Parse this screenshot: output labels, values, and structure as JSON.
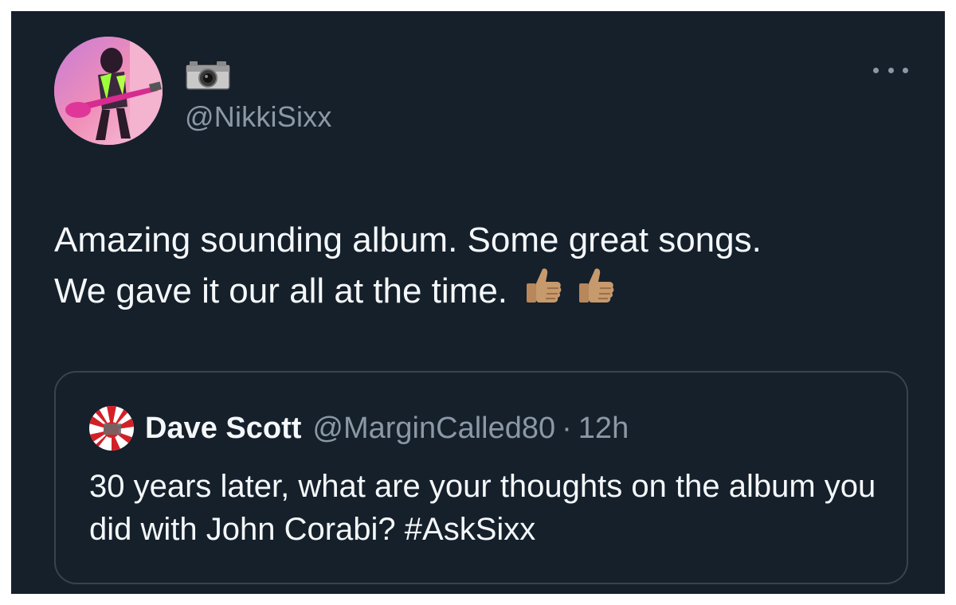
{
  "tweet": {
    "handle": "@NikkiSixx",
    "name_icons": [
      "camera-icon"
    ],
    "text": "Amazing sounding album. Some great songs.\nWe gave it our all at the time.",
    "emojis": [
      "thumbs-up-icon",
      "thumbs-up-icon"
    ],
    "more_icon": "more-options-icon"
  },
  "quote": {
    "name": "Dave Scott",
    "handle": "@MarginCalled80",
    "separator": "·",
    "time": "12h",
    "text": "30 years later, what are your thoughts on the album you did with John Corabi? #AskSixx"
  },
  "colors": {
    "background": "#15202b",
    "text": "#f5f8fa",
    "secondary": "#8b98a5",
    "border": "#38444d",
    "page": "#ffffff"
  }
}
